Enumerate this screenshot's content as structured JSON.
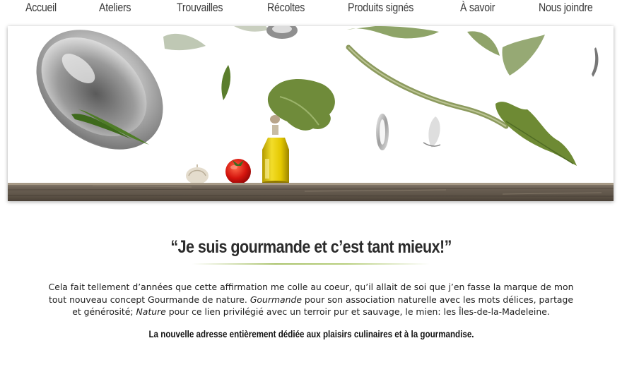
{
  "nav": {
    "items": [
      {
        "label": "Accueil"
      },
      {
        "label": "Ateliers"
      },
      {
        "label": "Trouvailles"
      },
      {
        "label": "Récoltes"
      },
      {
        "label": "Produits signés"
      },
      {
        "label": "À savoir"
      },
      {
        "label": "Nous joindre"
      }
    ]
  },
  "hero": {
    "icons": [
      "mixing-bowl-icon",
      "tomato-icon",
      "garlic-icon",
      "olive-oil-bottle-icon",
      "spoon-icon",
      "herb-leaves-icon",
      "wooden-table-icon"
    ]
  },
  "intro": {
    "quote": "“Je suis gourmande et c’est tant mieux!”",
    "paragraph_part1": "Cela fait tellement d’années que cette affirmation me colle au coeur, qu’il allait de soi que j’en fasse la marque de mon tout nouveau concept Gourmande de nature. ",
    "paragraph_em1": "Gourmande",
    "paragraph_part2": " pour son association naturelle avec les mots délices, partage et générosité; ",
    "paragraph_em2": "Nature",
    "paragraph_part3": " pour ce lien privilégié avec un terroir pur et sauvage, le mien: les Îles-de-la-Madeleine.",
    "tagline": "La nouvelle adresse entièrement dédiée aux plaisirs culinaires et à la gourmandise."
  },
  "colors": {
    "accent_green": "#a9c26a",
    "text": "#1e1e1e",
    "wood": "#6e6356"
  }
}
